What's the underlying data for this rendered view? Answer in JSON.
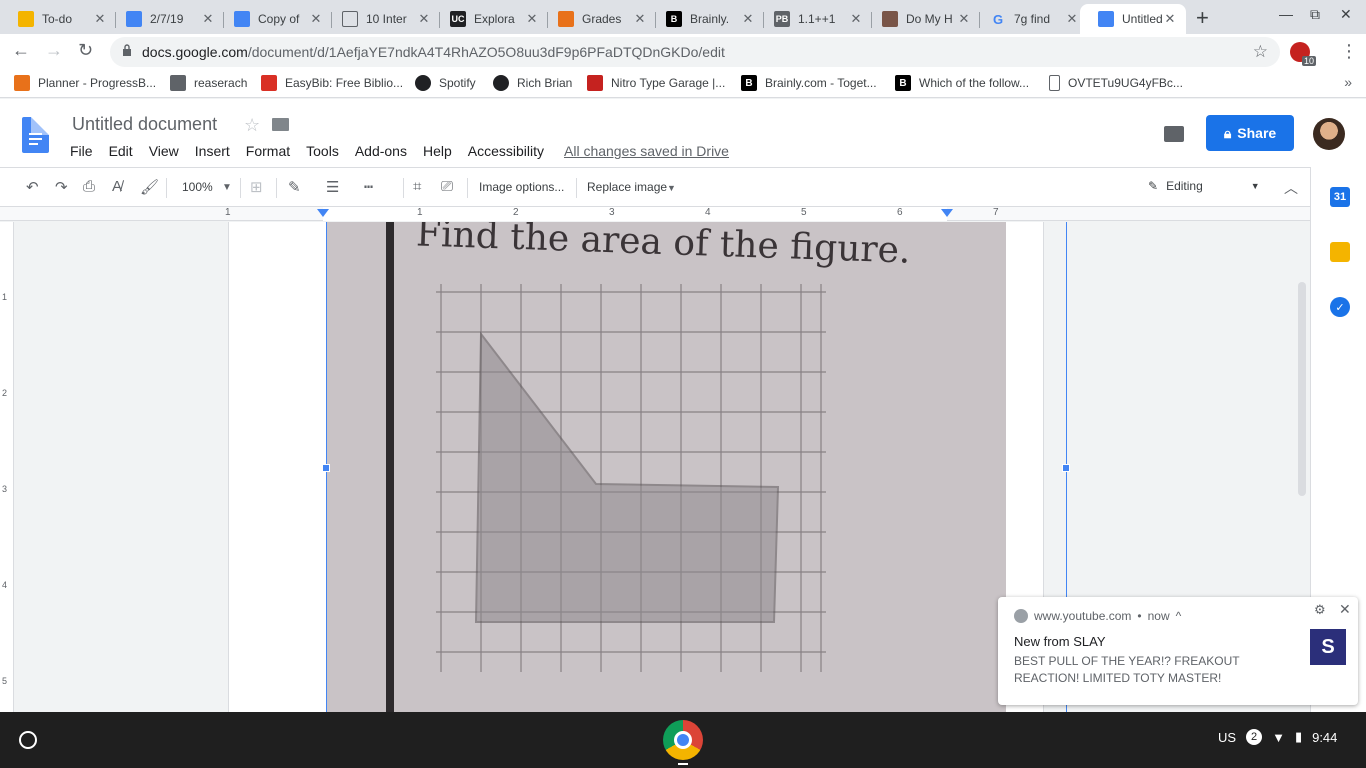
{
  "tabs": [
    {
      "title": "To-do",
      "color": "#f4b400",
      "glyph": ""
    },
    {
      "title": "2/7/19",
      "color": "#4285f4",
      "glyph": ""
    },
    {
      "title": "Copy of",
      "color": "#4285f4",
      "glyph": ""
    },
    {
      "title": "10 Inter",
      "color": "#ffffff",
      "glyph": ""
    },
    {
      "title": "Explora",
      "color": "#202124",
      "glyph": "UC"
    },
    {
      "title": "Grades",
      "color": "#e8711a",
      "glyph": ""
    },
    {
      "title": "Brainly.",
      "color": "#000000",
      "glyph": "B"
    },
    {
      "title": "1.1++1",
      "color": "#5f6368",
      "glyph": "PB"
    },
    {
      "title": "Do My H",
      "color": "#795548",
      "glyph": ""
    },
    {
      "title": "7g find",
      "color": "#ffffff",
      "glyph": "G"
    },
    {
      "title": "Untitled",
      "color": "#4285f4",
      "glyph": ""
    }
  ],
  "omnibox": {
    "host": "docs.google.com",
    "path": "/document/d/1AefjaYE7ndkA4T4RhAZO5O8uu3dF9p6PFaDTQDnGKDo/edit",
    "ext_badge": "10"
  },
  "bookmarks": [
    {
      "label": "Planner - ProgressB...",
      "color": "#e8711a"
    },
    {
      "label": "reaserach",
      "color": "#5f6368"
    },
    {
      "label": "EasyBib: Free Biblio...",
      "color": "#d93025"
    },
    {
      "label": "Spotify",
      "color": "#202124"
    },
    {
      "label": "Rich Brian",
      "color": "#202124"
    },
    {
      "label": "Nitro Type Garage |...",
      "color": "#c5221f"
    },
    {
      "label": "Brainly.com - Toget...",
      "color": "#000000"
    },
    {
      "label": "Which of the follow...",
      "color": "#000000"
    },
    {
      "label": "OVTETu9UG4yFBc...",
      "color": "#ffffff"
    }
  ],
  "docs": {
    "title": "Untitled document",
    "menu": [
      "File",
      "Edit",
      "View",
      "Insert",
      "Format",
      "Tools",
      "Add-ons",
      "Help",
      "Accessibility"
    ],
    "saved": "All changes saved in Drive",
    "share": "Share"
  },
  "toolbar": {
    "zoom": "100%",
    "image_options": "Image options...",
    "replace_image": "Replace image",
    "mode": "Editing"
  },
  "ruler": {
    "numbers": [
      "1",
      "1",
      "2",
      "3",
      "4",
      "5",
      "6",
      "7"
    ],
    "vnumbers": [
      "1",
      "2",
      "3",
      "4",
      "5"
    ]
  },
  "image": {
    "heading": "Find the area of the figure."
  },
  "notification": {
    "source": "www.youtube.com",
    "time": "now",
    "title": "New from SLAY",
    "body": "BEST PULL OF THE YEAR!? FREAKOUT REACTION! LIMITED TOTY MASTER!"
  },
  "shelf": {
    "ime": "US",
    "notif_count": "2",
    "time": "9:44"
  },
  "colors": {
    "accent": "#1a73e8",
    "selection": "#4285f4"
  }
}
